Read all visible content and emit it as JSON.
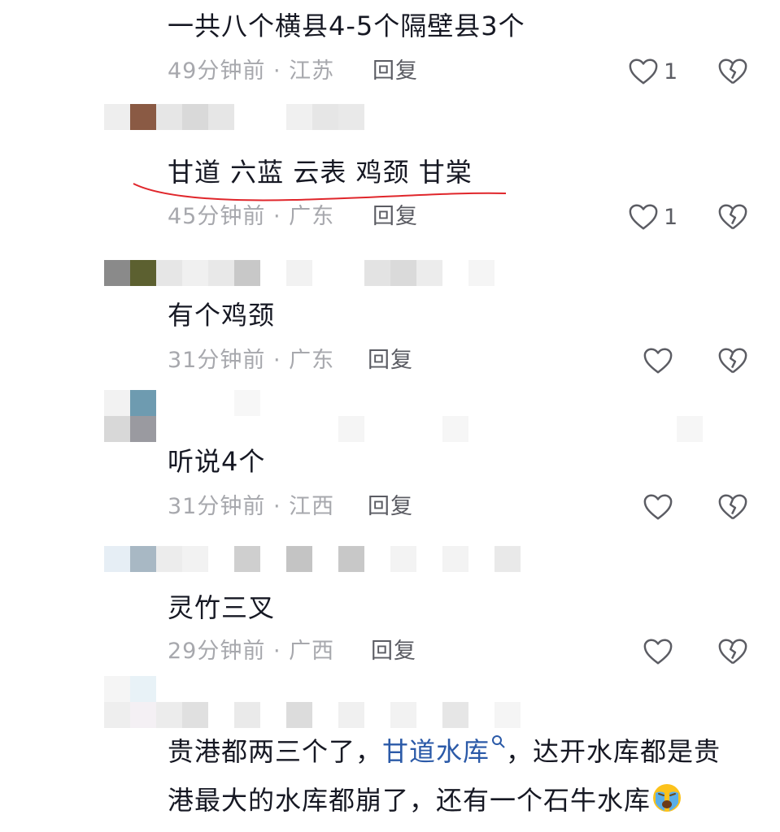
{
  "comments": [
    {
      "text": "一共八个横县4-5个隔壁县3个",
      "time": "49分钟前",
      "location": "江苏",
      "reply": "回复",
      "likes": "1"
    },
    {
      "text": "甘道  六蓝  云表  鸡颈  甘棠",
      "time": "45分钟前",
      "location": "广东",
      "reply": "回复",
      "likes": "1"
    },
    {
      "text": "有个鸡颈",
      "time": "31分钟前",
      "location": "广东",
      "reply": "回复",
      "likes": ""
    },
    {
      "text": "听说4个",
      "time": "31分钟前",
      "location": "江西",
      "reply": "回复",
      "likes": ""
    },
    {
      "text": "灵竹三叉",
      "time": "29分钟前",
      "location": "广西",
      "reply": "回复",
      "likes": ""
    },
    {
      "text_part1": "贵港都两三个了，",
      "link": "甘道水库",
      "text_part2": "，达开水库都是贵",
      "line2": "港最大的水库都崩了，还有一个石牛水库"
    }
  ],
  "separator": " · ",
  "icons": {
    "like": "heart-outline-icon",
    "dislike": "broken-heart-icon",
    "search": "search-icon",
    "emoji": "crying-emoji-icon"
  },
  "colors": {
    "text": "#161823",
    "meta": "#a7a8ad",
    "link": "#2b5aa8",
    "underline": "#e0262b"
  }
}
